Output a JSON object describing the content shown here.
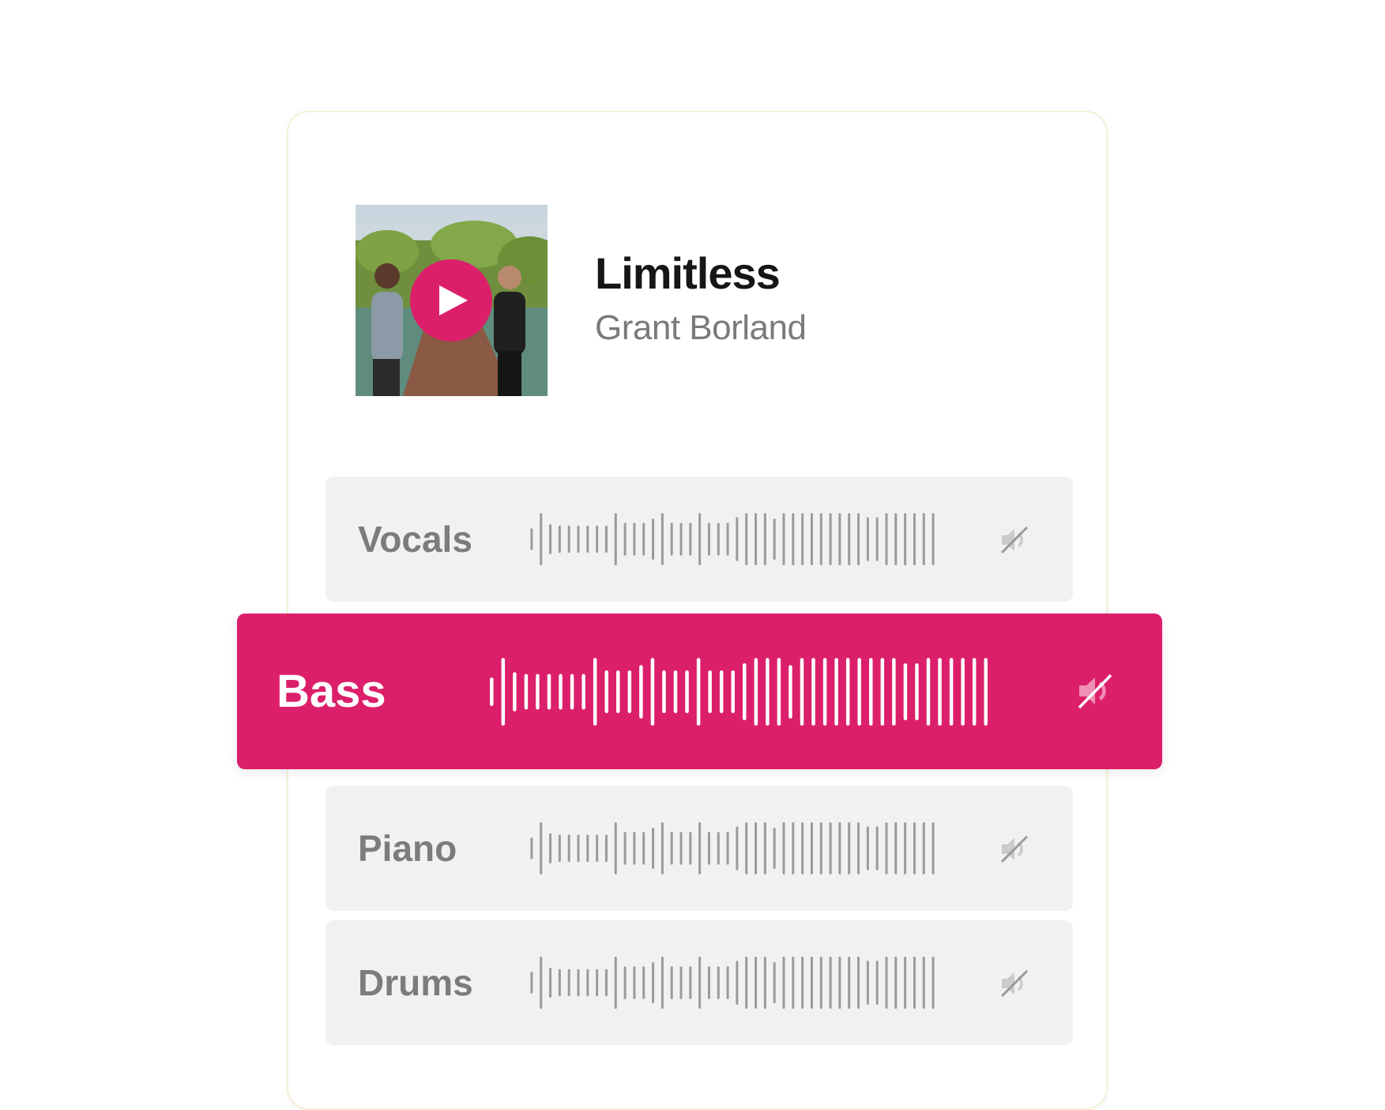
{
  "song": {
    "title": "Limitless",
    "artist": "Grant Borland"
  },
  "colors": {
    "accent": "#dc1f6a",
    "track_bg": "#f1f1f1",
    "inactive_text": "#7c7c7c",
    "inactive_wave": "#9a9a9a",
    "active_text": "#ffffff"
  },
  "icons": {
    "play": "play-icon",
    "mute": "speaker-muted-icon"
  },
  "tracks": [
    {
      "label": "Vocals",
      "active": false
    },
    {
      "label": "Bass",
      "active": true
    },
    {
      "label": "Piano",
      "active": false
    },
    {
      "label": "Drums",
      "active": false
    }
  ]
}
